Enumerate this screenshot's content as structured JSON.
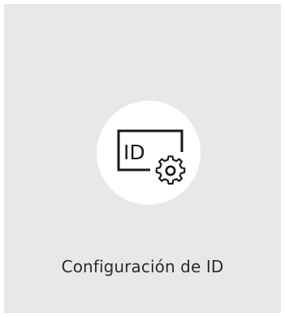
{
  "tile": {
    "label": "Configuración de ID",
    "icon": "id-settings-icon",
    "icon_glyph_text": "ID"
  },
  "colors": {
    "tile_background": "#e8e8e8",
    "icon_circle": "#ffffff",
    "icon_stroke": "#1a1a1a",
    "label_text": "#2b2b2b"
  }
}
